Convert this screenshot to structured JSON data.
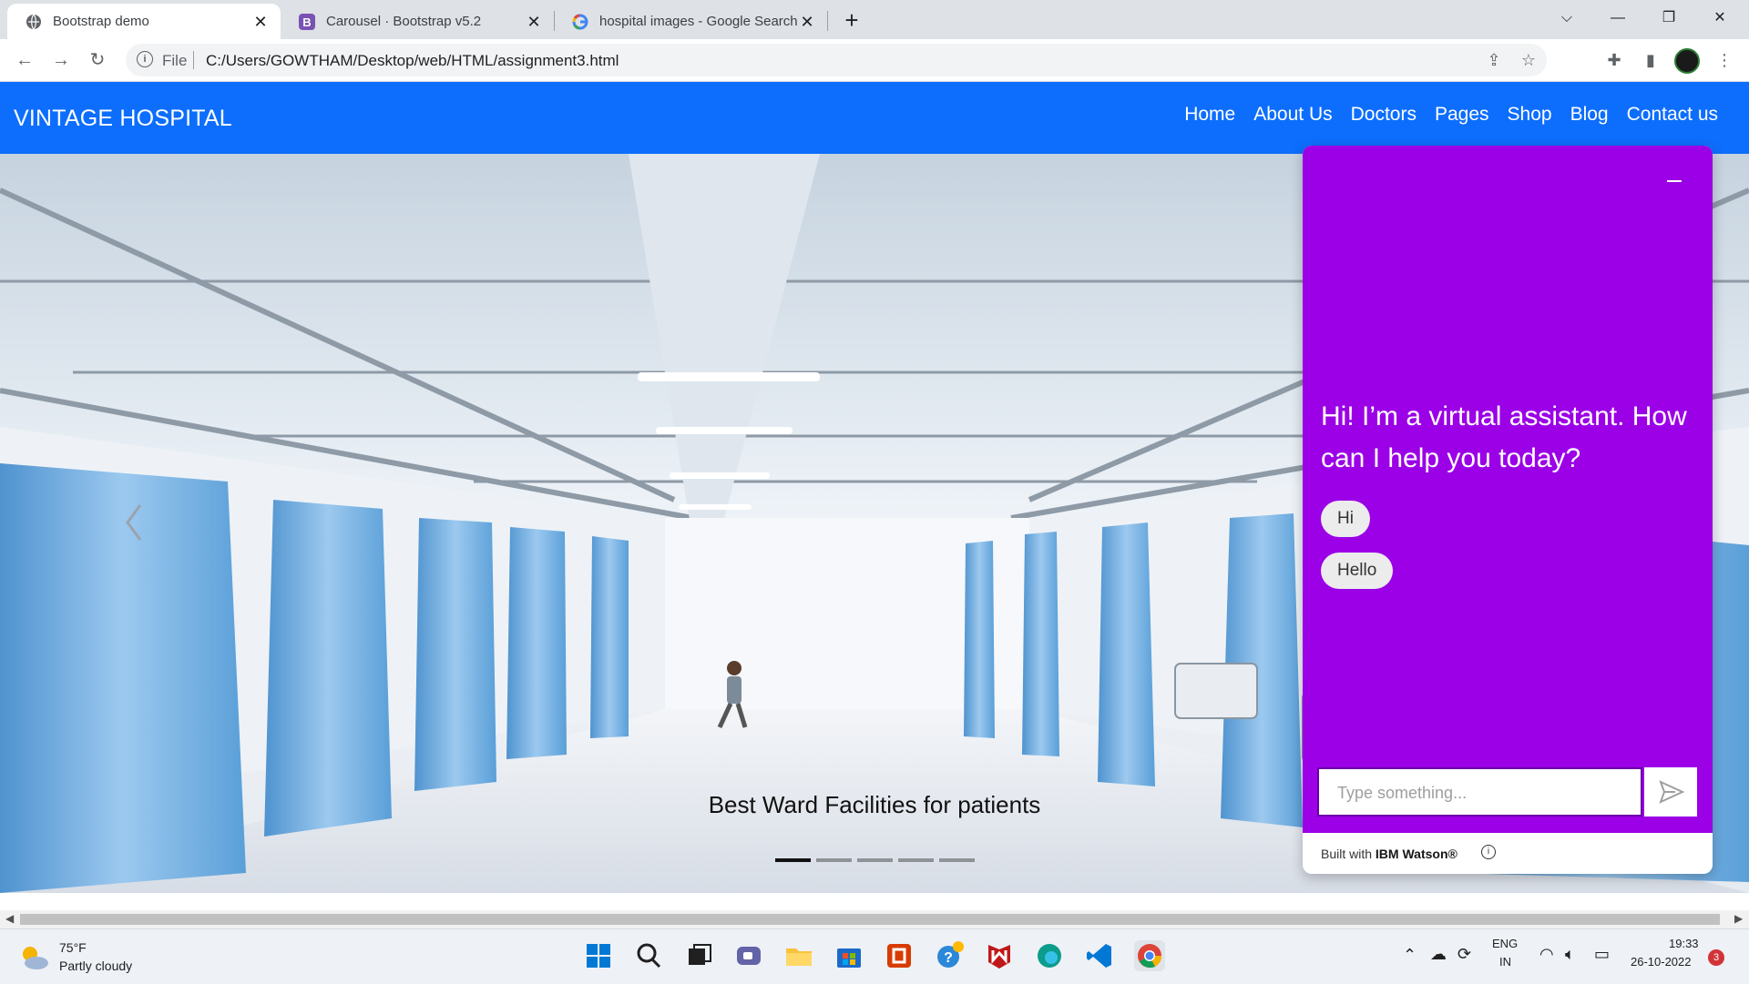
{
  "browser": {
    "tabs": [
      {
        "title": "Bootstrap demo",
        "active": true,
        "favicon": "globe-icon"
      },
      {
        "title": "Carousel · Bootstrap v5.2",
        "active": false,
        "favicon": "bootstrap-icon"
      },
      {
        "title": "hospital images - Google Search",
        "active": false,
        "favicon": "google-icon"
      }
    ],
    "address": {
      "scheme_label": "File",
      "url": "C:/Users/GOWTHAM/Desktop/web/HTML/assignment3.html"
    }
  },
  "site": {
    "brand": "VINTAGE HOSPITAL",
    "nav": [
      "Home",
      "About Us",
      "Doctors",
      "Pages",
      "Shop",
      "Blog",
      "Contact us"
    ],
    "brand_color": "#0d6efd"
  },
  "carousel": {
    "caption": "Best Ward Facilities for patients",
    "slides": 5,
    "active_slide": 1
  },
  "chat": {
    "greeting": "Hi! I’m a virtual assistant. How can I help you today?",
    "options": [
      "Hi",
      "Hello"
    ],
    "input_placeholder": "Type something...",
    "footer_prefix": "Built with",
    "footer_brand": "IBM Watson®",
    "accent": "#9b00e6"
  },
  "taskbar": {
    "weather_temp": "75°F",
    "weather_cond": "Partly cloudy",
    "lang_top": "ENG",
    "lang_bottom": "IN",
    "time": "19:33",
    "date": "26-10-2022",
    "notifications": "3"
  }
}
